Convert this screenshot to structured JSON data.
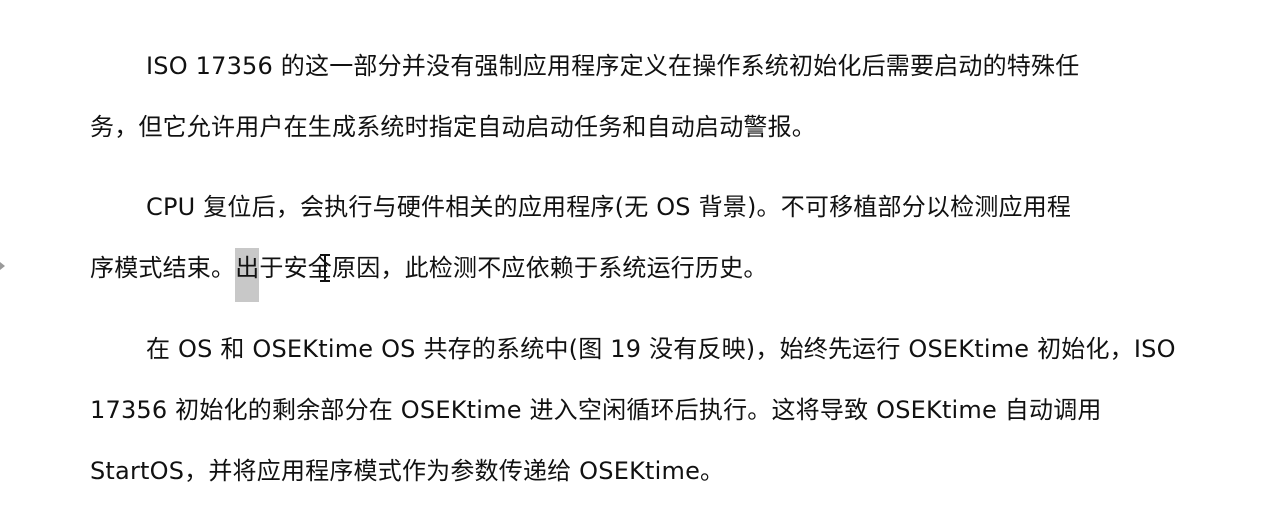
{
  "document": {
    "paragraph1": {
      "line1": "ISO 17356 的这一部分并没有强制应用程序定义在操作系统初始化后需要启动的特殊任",
      "line2": "务，但它允许用户在生成系统时指定自动启动任务和自动启动警报。"
    },
    "paragraph2": {
      "line1": "CPU 复位后，会执行与硬件相关的应用程序(无 OS 背景)。不可移植部分以检测应用程",
      "line2_before": "序模式结束。",
      "line2_selected": "出",
      "line2_after": "于安全原因，此检测不应依赖于系统运行历史。"
    },
    "paragraph3": {
      "line1": "在 OS 和 OSEKtime OS 共存的系统中(图 19 没有反映)，始终先运行 OSEKtime 初始化，ISO",
      "line2": "17356 初始化的剩余部分在 OSEKtime 进入空闲循环后执行。这将导致 OSEKtime 自动调用",
      "line3": "StartOS，并将应用程序模式作为参数传递给 OSEKtime。"
    }
  },
  "cursor": {
    "icon": "text-cursor-icon"
  },
  "colors": {
    "text": "#111111",
    "selection": "#c8c8c8",
    "background": "#ffffff"
  }
}
